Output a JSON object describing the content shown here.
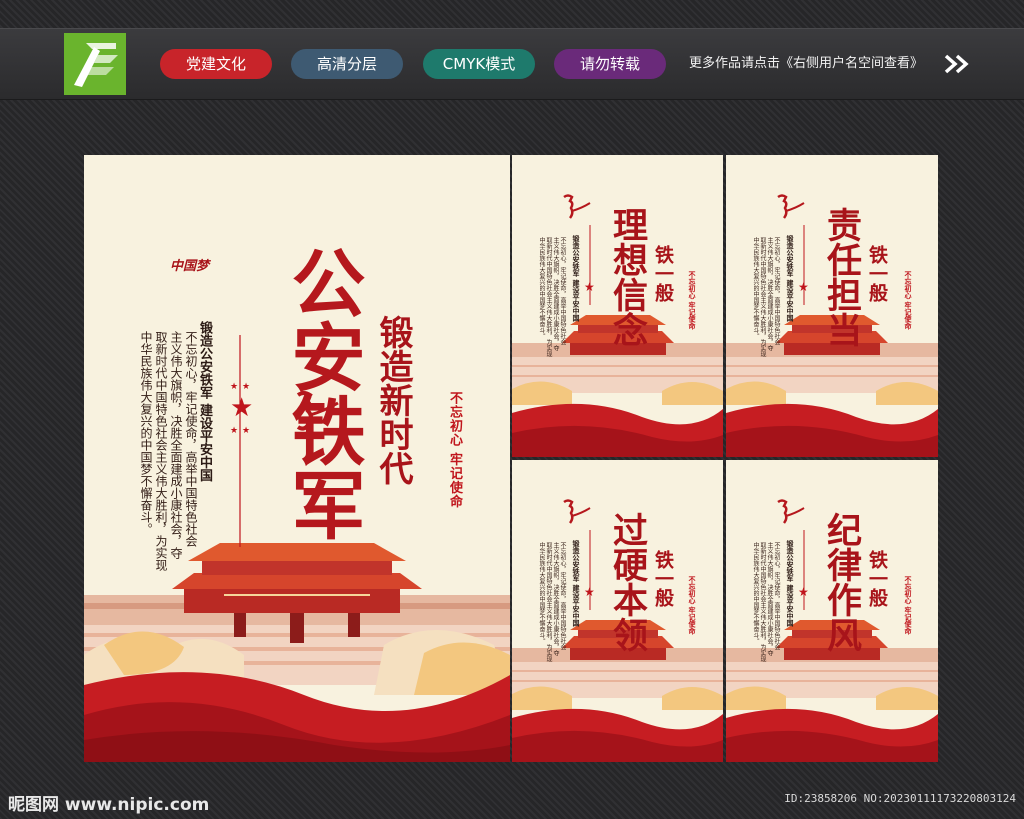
{
  "header": {
    "tags": [
      {
        "label": "党建文化",
        "color": "#c8242a"
      },
      {
        "label": "高清分层",
        "color": "#3e5a72"
      },
      {
        "label": "CMYK模式",
        "color": "#1e7a6c"
      },
      {
        "label": "请勿转载",
        "color": "#6a2a7a"
      }
    ],
    "note": "更多作品请点击《右侧用户名空间查看》",
    "logo_icon": "pen-nib-icon",
    "arrow_icon": "double-chevron-right-icon"
  },
  "main_poster": {
    "title": "公安铁军",
    "subtitle": "锻造新时代",
    "slogan": "不忘初心  牢记使命",
    "motto": "锻造公安铁军  建设平安中国",
    "body": [
      "不忘初心，牢记使命，高举中国特色社会",
      "主义伟大旗帜，决胜全面建成小康社会，夺",
      "取新时代中国特色社会主义伟大胜利，为实现",
      "中华民族伟大复兴的中国梦不懈奋斗。"
    ],
    "brand": "中国梦"
  },
  "small_posters": [
    {
      "title": "理想信念",
      "subtitle": "铁一般",
      "slogan": "不忘初心  牢记使命",
      "motto": "锻造公安铁军  建设平安中国"
    },
    {
      "title": "责任担当",
      "subtitle": "铁一般",
      "slogan": "不忘初心  牢记使命",
      "motto": "锻造公安铁军  建设平安中国"
    },
    {
      "title": "过硬本领",
      "subtitle": "铁一般",
      "slogan": "不忘初心  牢记使命",
      "motto": "锻造公安铁军  建设平安中国"
    },
    {
      "title": "纪律作风",
      "subtitle": "铁一般",
      "slogan": "不忘初心  牢记使命",
      "motto": "锻造公安铁军  建设平安中国"
    }
  ],
  "footer": {
    "site": "昵图网 www.nipic.com",
    "id": "ID:23858206 NO:20230111173220803124"
  },
  "colors": {
    "primary_red": "#b5181d",
    "panel_bg": "#f8f2df",
    "logo_green": "#6ab42d"
  }
}
